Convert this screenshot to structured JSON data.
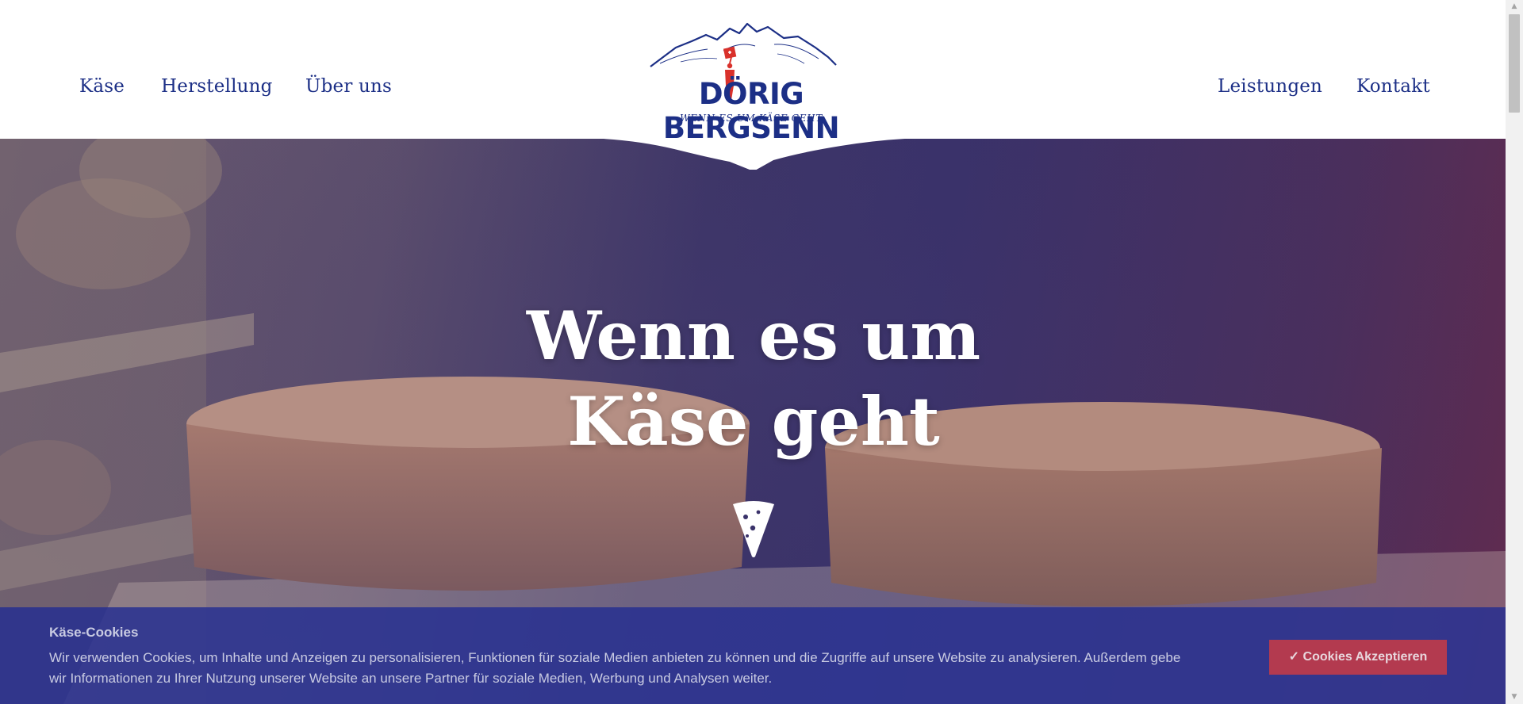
{
  "header": {
    "nav_left": [
      "Käse",
      "Herstellung",
      "Über uns"
    ],
    "nav_right": [
      "Leistungen",
      "Kontakt"
    ],
    "logo": {
      "name": "DÖRIG BERGSENN",
      "tagline": "WENN ES UM KÄSE GEHT",
      "icon": "mountain-yodeler-flag-logo"
    }
  },
  "hero": {
    "title_line1": "Wenn es um",
    "title_line2": "Käse geht",
    "icon": "cheese-slice-icon"
  },
  "cookie_banner": {
    "title": "Käse-Cookies",
    "text_line1": "Wir verwenden Cookies, um Inhalte und Anzeigen zu personalisieren, Funktionen für soziale Medien anbieten zu können und die Zugriffe auf unsere Website zu analysieren. Außerdem gebe",
    "text_line2": "wir Informationen zu Ihrer Nutzung unserer Website an unsere Partner für soziale Medien, Werbung und Analysen weiter.",
    "accept_label": "✓ Cookies Akzeptieren"
  },
  "colors": {
    "brand_blue": "#1c2f86",
    "brand_red": "#d9312b",
    "cookie_bg": "#232d91",
    "accept_bg": "#b33a4f"
  }
}
